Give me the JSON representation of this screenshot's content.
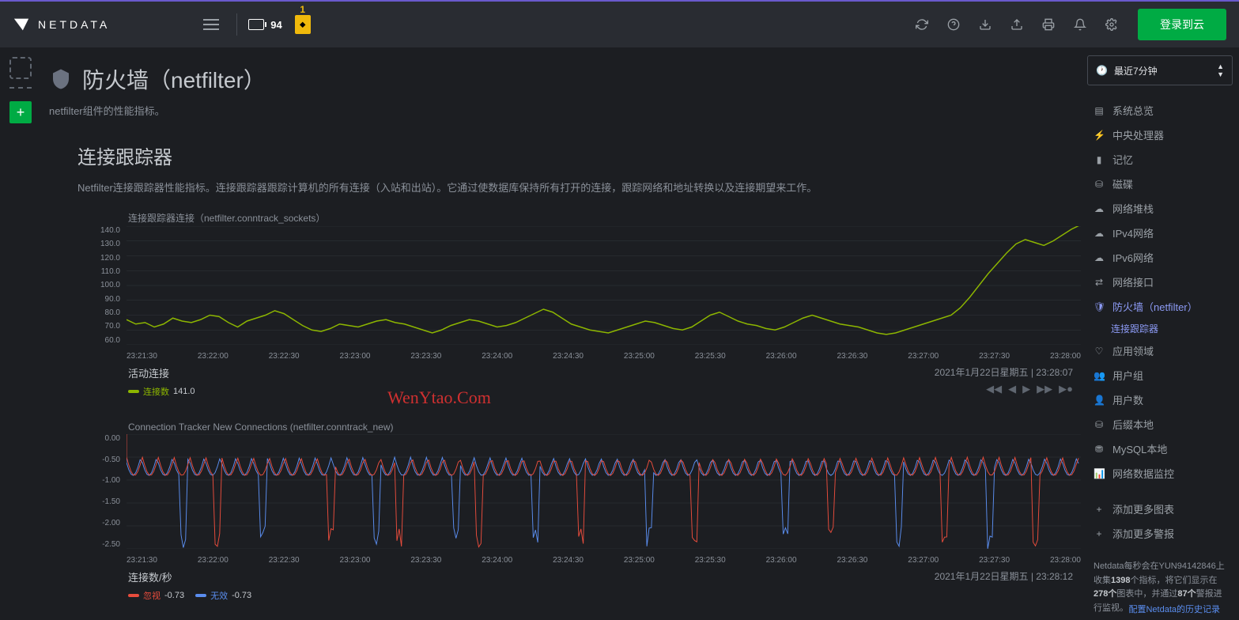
{
  "header": {
    "brand": "NETDATA",
    "stat_value": "94",
    "alert_count": "1",
    "login_label": "登录到云"
  },
  "page": {
    "title": "防火墙（netfilter）",
    "subtitle": "netfilter组件的性能指标。"
  },
  "section": {
    "title": "连接跟踪器",
    "desc": "Netfilter连接跟踪器性能指标。连接跟踪器跟踪计算机的所有连接（入站和出站）。它通过使数据库保持所有打开的连接，跟踪网络和地址转换以及连接期望来工作。"
  },
  "chart1": {
    "title": "连接跟踪器连接（netfilter.conntrack_sockets）",
    "footer_label": "活动连接",
    "timestamp": "2021年1月22日星期五 | 23:28:07",
    "legend_name": "连接数",
    "legend_value": "141.0"
  },
  "chart2": {
    "title": "Connection Tracker New Connections (netfilter.conntrack_new)",
    "footer_label": "连接数/秒",
    "timestamp": "2021年1月22日星期五 | 23:28:12",
    "legend1_name": "忽视",
    "legend1_value": "-0.73",
    "legend2_name": "无效",
    "legend2_value": "-0.73"
  },
  "time_picker": "最近7分钟",
  "nav": {
    "items": [
      {
        "icon": "▤",
        "label": "系统总览"
      },
      {
        "icon": "⚡",
        "label": "中央处理器"
      },
      {
        "icon": "▮",
        "label": "记忆"
      },
      {
        "icon": "⛁",
        "label": "磁碟"
      },
      {
        "icon": "☁",
        "label": "网络堆栈"
      },
      {
        "icon": "☁",
        "label": "IPv4网络"
      },
      {
        "icon": "☁",
        "label": "IPv6网络"
      },
      {
        "icon": "⇄",
        "label": "网络接口"
      }
    ],
    "active": {
      "icon": "🛡",
      "label": "防火墙（netfilter）"
    },
    "sub": "连接跟踪器",
    "items2": [
      {
        "icon": "♡",
        "label": "应用领域"
      },
      {
        "icon": "👥",
        "label": "用户组"
      },
      {
        "icon": "👤",
        "label": "用户数"
      },
      {
        "icon": "⛁",
        "label": "后缀本地"
      },
      {
        "icon": "⛃",
        "label": "MySQL本地"
      },
      {
        "icon": "📊",
        "label": "网络数据监控"
      }
    ],
    "add1": "添加更多图表",
    "add2": "添加更多警报"
  },
  "info": {
    "prefix": "Netdata每秒会在",
    "host": "YUN94142846",
    "t1": "上收集",
    "metrics": "1398",
    "t2": "个指标，将它们显示在",
    "charts": "278个",
    "t3": "图表中，并通过",
    "alarms": "87个",
    "t4": "警报进行监视。"
  },
  "footer_link": "配置Netdata的历史记录",
  "chart_data": [
    {
      "type": "line",
      "title": "连接跟踪器连接（netfilter.conntrack_sockets）",
      "ylabel": "活动连接",
      "ylim": [
        60,
        140
      ],
      "yticks": [
        60,
        70,
        80,
        90,
        100,
        110,
        120,
        130,
        140
      ],
      "x_ticks": [
        "23:21:30",
        "23:22:00",
        "23:22:30",
        "23:23:00",
        "23:23:30",
        "23:24:00",
        "23:24:30",
        "23:25:00",
        "23:25:30",
        "23:26:00",
        "23:26:30",
        "23:27:00",
        "23:27:30",
        "23:28:00"
      ],
      "series": [
        {
          "name": "连接数",
          "color": "#8db600",
          "values": [
            77,
            74,
            75,
            72,
            74,
            78,
            76,
            75,
            77,
            80,
            79,
            75,
            72,
            76,
            78,
            80,
            83,
            81,
            77,
            73,
            70,
            69,
            71,
            74,
            73,
            72,
            74,
            76,
            77,
            75,
            74,
            72,
            70,
            68,
            70,
            73,
            75,
            77,
            76,
            74,
            72,
            73,
            75,
            78,
            81,
            84,
            82,
            78,
            74,
            72,
            70,
            69,
            68,
            70,
            72,
            74,
            76,
            75,
            73,
            71,
            70,
            72,
            76,
            80,
            82,
            79,
            76,
            74,
            73,
            71,
            70,
            72,
            75,
            78,
            80,
            78,
            76,
            74,
            73,
            72,
            70,
            68,
            67,
            68,
            70,
            72,
            74,
            76,
            78,
            80,
            85,
            92,
            100,
            108,
            115,
            122,
            128,
            131,
            129,
            127,
            130,
            134,
            138,
            141
          ]
        }
      ]
    },
    {
      "type": "line",
      "title": "Connection Tracker New Connections (netfilter.conntrack_new)",
      "ylabel": "连接数/秒",
      "ylim": [
        -2.5,
        0
      ],
      "yticks": [
        0,
        -0.5,
        -1,
        -1.5,
        -2,
        -2.5
      ],
      "x_ticks": [
        "23:21:30",
        "23:22:00",
        "23:22:30",
        "23:23:00",
        "23:23:30",
        "23:24:00",
        "23:24:30",
        "23:25:00",
        "23:25:30",
        "23:26:00",
        "23:26:30",
        "23:27:00",
        "23:27:30",
        "23:28:00"
      ],
      "series": [
        {
          "name": "忽视",
          "color": "#e74c3c"
        },
        {
          "name": "无效",
          "color": "#5a8dee"
        }
      ]
    }
  ]
}
